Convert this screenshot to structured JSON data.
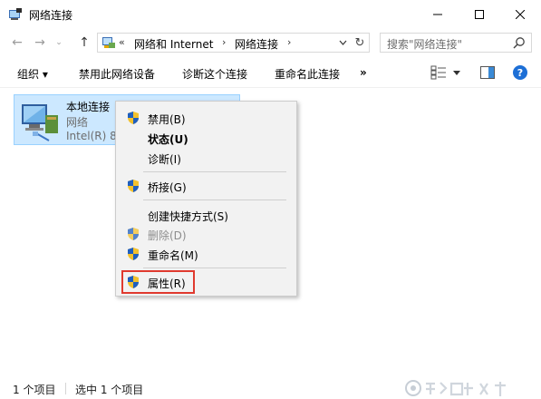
{
  "window": {
    "title": "网络连接"
  },
  "nav": {
    "back_glyph": "←",
    "forward_glyph": "→",
    "recent_glyph": "⌄",
    "up_glyph": "↑"
  },
  "address": {
    "overflow": "«",
    "crumbs": [
      "网络和 Internet",
      "网络连接"
    ],
    "sep": "›",
    "refresh_glyph": "↻"
  },
  "search": {
    "placeholder": "搜索\"网络连接\""
  },
  "commands": {
    "organize": "组织 ▾",
    "disable_device": "禁用此网络设备",
    "diagnose": "诊断这个连接",
    "rename": "重命名此连接",
    "more": "»",
    "help": "?"
  },
  "item": {
    "name": "本地连接",
    "type": "网络",
    "device": "Intel(R) 82"
  },
  "context_menu": {
    "items": [
      {
        "label": "禁用(B)",
        "shield": true,
        "bold": false,
        "disabled": false
      },
      {
        "label": "状态(U)",
        "shield": false,
        "bold": true,
        "disabled": false
      },
      {
        "label": "诊断(I)",
        "shield": false,
        "bold": false,
        "disabled": false
      },
      {
        "label": "桥接(G)",
        "shield": true,
        "bold": false,
        "disabled": false
      },
      {
        "label": "创建快捷方式(S)",
        "shield": false,
        "bold": false,
        "disabled": false
      },
      {
        "label": "删除(D)",
        "shield": true,
        "bold": false,
        "disabled": true
      },
      {
        "label": "重命名(M)",
        "shield": true,
        "bold": false,
        "disabled": false
      },
      {
        "label": "属性(R)",
        "shield": true,
        "bold": false,
        "disabled": false
      }
    ]
  },
  "status": {
    "count": "1 个项目",
    "selected": "选中 1 个项目"
  },
  "colors": {
    "selection_bg": "#cce8ff",
    "highlight_border": "#e03a2f",
    "shield_blue": "#1f5fbf",
    "shield_yellow": "#f2c12e"
  }
}
